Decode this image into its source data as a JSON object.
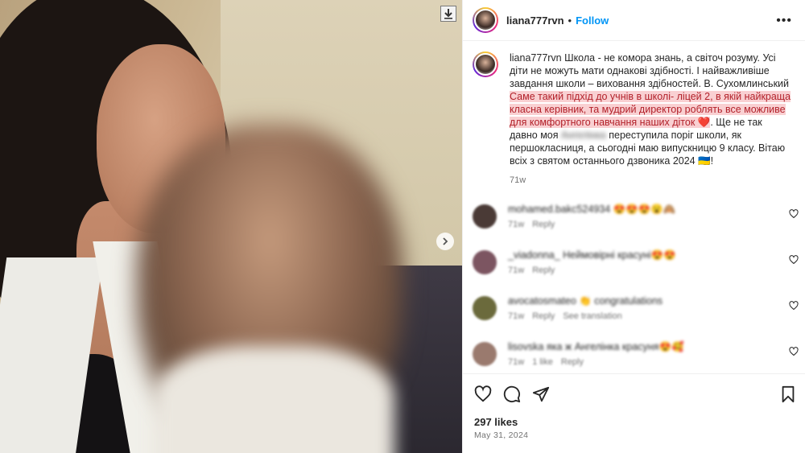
{
  "post": {
    "username": "liana777rvn",
    "separator": "•",
    "follow_label": "Follow",
    "more_label": "•••"
  },
  "caption": {
    "username": "liana777rvn",
    "text_part1": " Школа - не комора знань, а світоч розуму. Усі діти не можуть мати однакові здібності. І найважливіше завдання школи – виховання здібностей. В. Сухомлинський",
    "highlighted": "Саме такий підхід до учнів в школі- ліцей 2, в якій найкраща класна керівник, та мудрий директор роблять все можливе для комфортного навчання наших діток ❤️",
    "text_part2": ". Ще не так давно моя",
    "blurred_name": "Ангелінка",
    "text_part3": " переступила поріг школи, як першокласниця, а сьогодні маю випускницю 9 класу. Вітаю всіх з святом останнього дзвоника 2024 🇺🇦!",
    "time": "71w"
  },
  "comments": [
    {
      "text": "mohamed.bakc524934 😍😍😍😮🙈",
      "time": "71w",
      "reply": "Reply",
      "extra": "",
      "color": "#4a3a36"
    },
    {
      "text": "_viadonna_ Неймовірні красуні😍😍",
      "time": "71w",
      "reply": "Reply",
      "extra": "",
      "color": "#7c5561"
    },
    {
      "text": "avocatosmateo 👏 congratulations",
      "time": "71w",
      "reply": "Reply",
      "extra": "See translation",
      "color": "#6b6a3c"
    },
    {
      "text": "lisovskа яка ж Ангелінка красуня😍🥰",
      "time": "71w",
      "reply": "Reply",
      "extra": "1 like",
      "color": "#9a7a6e"
    }
  ],
  "footer": {
    "likes": "297 likes",
    "date": "May 31, 2024"
  },
  "icons": [
    "download-icon",
    "chevron-right-icon",
    "heart-icon",
    "comment-icon",
    "share-icon",
    "bookmark-icon"
  ]
}
